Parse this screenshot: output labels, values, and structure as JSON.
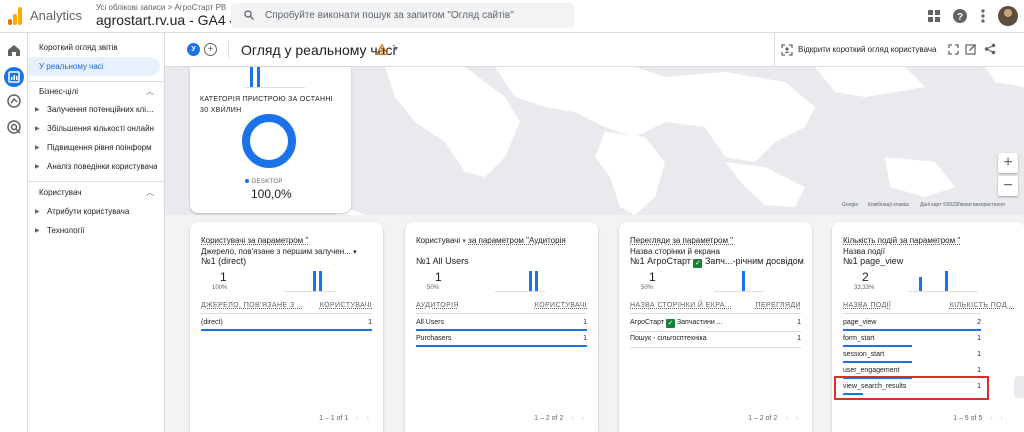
{
  "app": {
    "name": "Analytics",
    "account_path": "Усі облікові записи > АгроСтарт РВ",
    "property": "agrostart.rv.ua - GA4"
  },
  "search": {
    "placeholder": "Спробуйте виконати пошук за запитом \"Огляд сайтів\""
  },
  "nav": {
    "items": [
      "Короткий огляд звітів",
      "У реальному часі"
    ],
    "section1": "Бізнес-цілі",
    "section1_items": [
      "Залучення потенційних клієнтів",
      "Збільшення кількості онлайн",
      "Підвищення рівня поінформ",
      "Аналіз поведінки користувача"
    ],
    "section2": "Користувач",
    "section2_items": [
      "Атрибути користувача",
      "Технології"
    ]
  },
  "header": {
    "chip": "У",
    "title": "Огляд у реальному часі",
    "open_overview": "Відкрити короткий огляд користувача"
  },
  "map": {
    "keyboard": "Комбінації клавіш",
    "data": "Дані карт ©2023",
    "terms": "Умови використання",
    "zoom_in": "+",
    "zoom_out": "−"
  },
  "device_card": {
    "title": "КАТЕГОРІЯ ПРИСТРОЮ ЗА ОСТАННІ 30 ХВИЛИН",
    "legend": "DESKTOP",
    "value": "100,0%",
    "share": 1.0
  },
  "cards": [
    {
      "title": "Користувачі за параметром \"",
      "subtitle": "Джерело, пов'язане з першим залучен...",
      "top": "№1  (direct)",
      "num": "1",
      "pct": "100%",
      "col1": "ДЖЕРЕЛО, ПОВ'ЯЗАНЕ З ...",
      "col2": "КОРИСТУВАЧІ",
      "rows": [
        {
          "k": "(direct)",
          "v": "1"
        }
      ],
      "pager": "1 – 1 of 1"
    },
    {
      "title": "Користувачі",
      "title2": "за параметром \"Аудиторія",
      "subtitle": "",
      "top": "№1  All Users",
      "num": "1",
      "pct": "50%",
      "col1": "АУДИТОРІЯ",
      "col2": "КОРИСТУВАЧІ",
      "rows": [
        {
          "k": "All Users",
          "v": "1"
        },
        {
          "k": "Purchasers",
          "v": "1"
        }
      ],
      "pager": "1 – 2 of 2"
    },
    {
      "title": "Перегляди за параметром \"",
      "subtitle": "Назва сторінки й екрана",
      "top_a": "№1  АгроСтарт",
      "top_b": "Запч...-річним досвідом",
      "num": "1",
      "pct": "50%",
      "col1": "НАЗВА СТОРІНКИ Й ЕКРА...",
      "col2": "ПЕРЕГЛЯДИ",
      "rows": [
        {
          "k": "АгроСтарт",
          "k2": "Запчастини ...",
          "v": "1"
        },
        {
          "k": "Пошук - сільгосптехніка",
          "v": "1"
        }
      ],
      "pager": "1 – 2 of 2"
    },
    {
      "title": "Кількість подій за параметром \"",
      "subtitle": "Назва події",
      "top": "№1  page_view",
      "num": "2",
      "pct": "33,33%",
      "col1": "НАЗВА ПОДІЇ",
      "col2": "КІЛЬКІСТЬ ПОД...",
      "rows": [
        {
          "k": "page_view",
          "v": "2"
        },
        {
          "k": "form_start",
          "v": "1"
        },
        {
          "k": "session_start",
          "v": "1"
        },
        {
          "k": "user_engagement",
          "v": "1"
        },
        {
          "k": "view_search_results",
          "v": "1"
        }
      ],
      "pager": "1 – 5 of 5"
    }
  ]
}
